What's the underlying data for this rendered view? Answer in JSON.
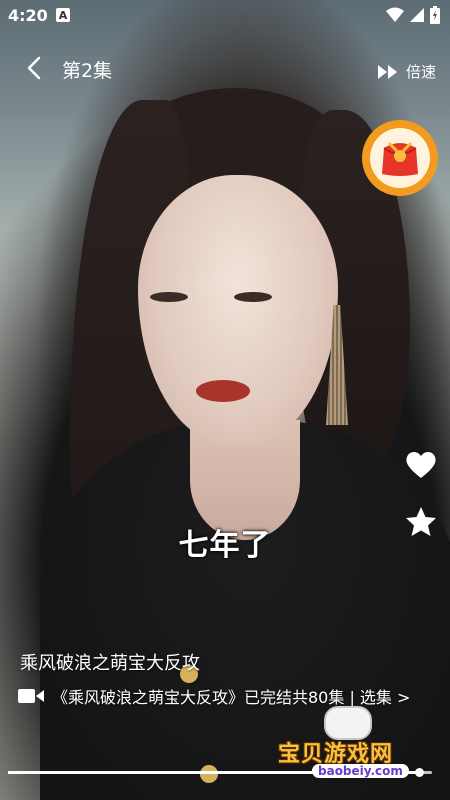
{
  "status_bar": {
    "time": "4:20",
    "notification_letter": "A"
  },
  "header": {
    "episode": "第2集",
    "speed_label": "倍速"
  },
  "subtitle": "七年了",
  "drama": {
    "title": "乘风破浪之萌宝大反攻",
    "info": "《乘风破浪之萌宝大反攻》已完结共80集 | 选集 >"
  },
  "progress": {
    "fraction": 0.97
  },
  "watermark": {
    "text": "宝贝游戏网",
    "url": "baobeiy.com"
  },
  "icons": {
    "back": "chevron-left-icon",
    "speed": "double-play-icon",
    "gift": "red-envelope-icon",
    "like": "heart-icon",
    "favorite": "star-icon",
    "video": "video-camera-icon"
  },
  "colors": {
    "gift_ring": "#f29b1e",
    "watermark_gold": "#f7c23c"
  }
}
